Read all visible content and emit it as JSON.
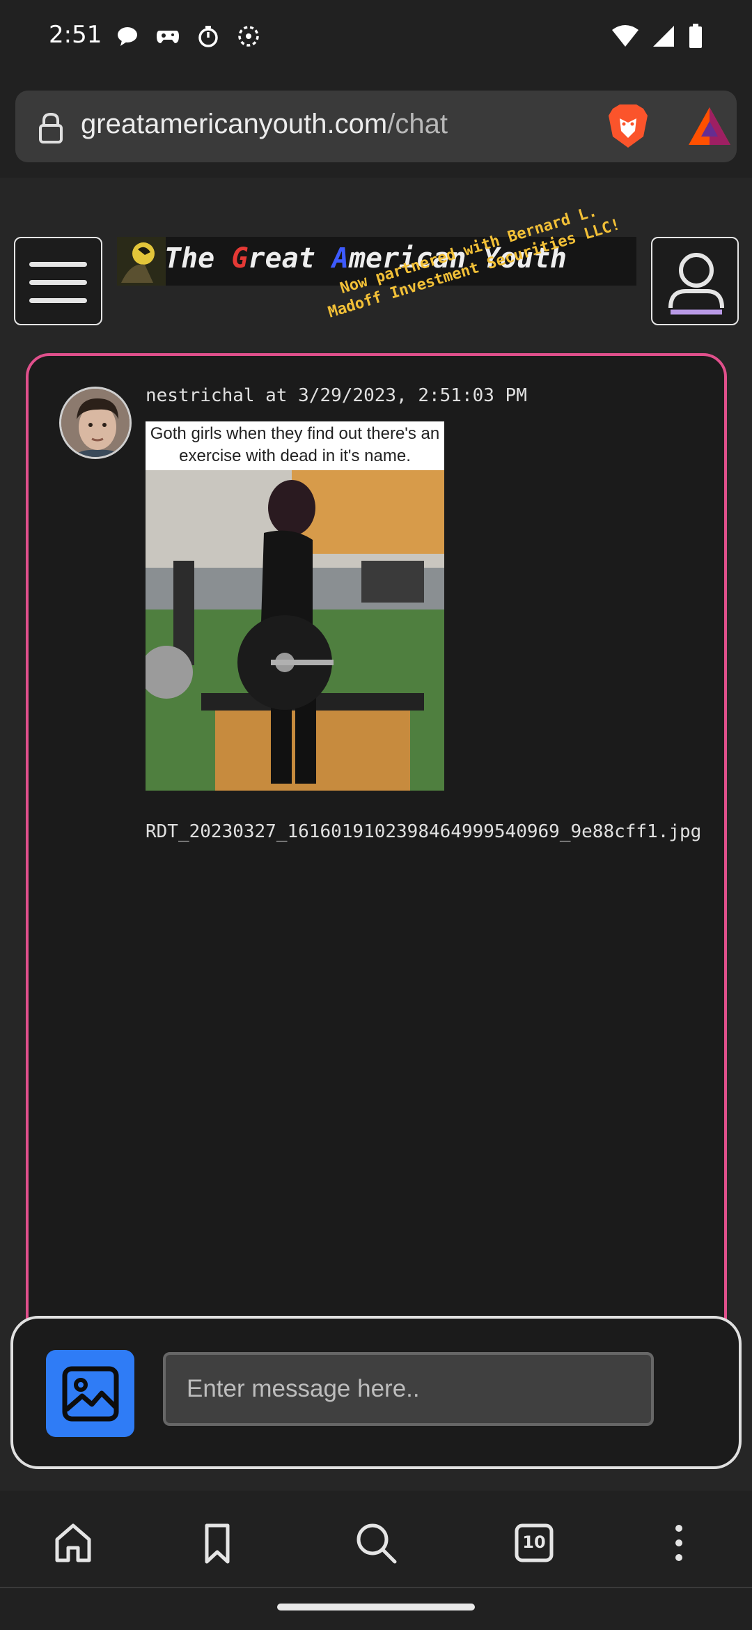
{
  "status_bar": {
    "time": "2:51",
    "left_icons": [
      "chat-bubble-icon",
      "game-controller-icon",
      "stopwatch-icon",
      "canvas-icon"
    ],
    "right_icons": [
      "wifi-icon",
      "cell-signal-icon",
      "battery-icon"
    ]
  },
  "browser": {
    "url_domain": "greatamericanyouth.com",
    "url_path": "/chat",
    "shield_icon": "brave-lion-icon",
    "rewards_icon": "bat-rewards-icon"
  },
  "header": {
    "title_prefix": "The ",
    "title_g": "G",
    "title_mid": "reat ",
    "title_a": "A",
    "title_suffix": "merican Youth",
    "promo": "Now partnered with Bernard L.\nMadoff Investment Securities LLC!"
  },
  "message": {
    "author_line": "nestrichal at 3/29/2023, 2:51:03 PM",
    "image_caption": "Goth girls when they find out there's an exercise with dead in it's name.",
    "filename": "RDT_20230327_1616019102398464999540969_9e88cff1.jpg"
  },
  "composer": {
    "placeholder": "Enter message here..",
    "value": ""
  },
  "bottom_nav": {
    "tab_count": "10",
    "items": [
      "home-icon",
      "bookmark-icon",
      "search-icon",
      "tabs-icon",
      "more-icon"
    ]
  },
  "colors": {
    "chat_border": "#e0508c",
    "upload_button": "#2f7cf6",
    "promo_text": "#f2c037",
    "title_g": "#e53935",
    "title_a": "#3d5afe"
  }
}
